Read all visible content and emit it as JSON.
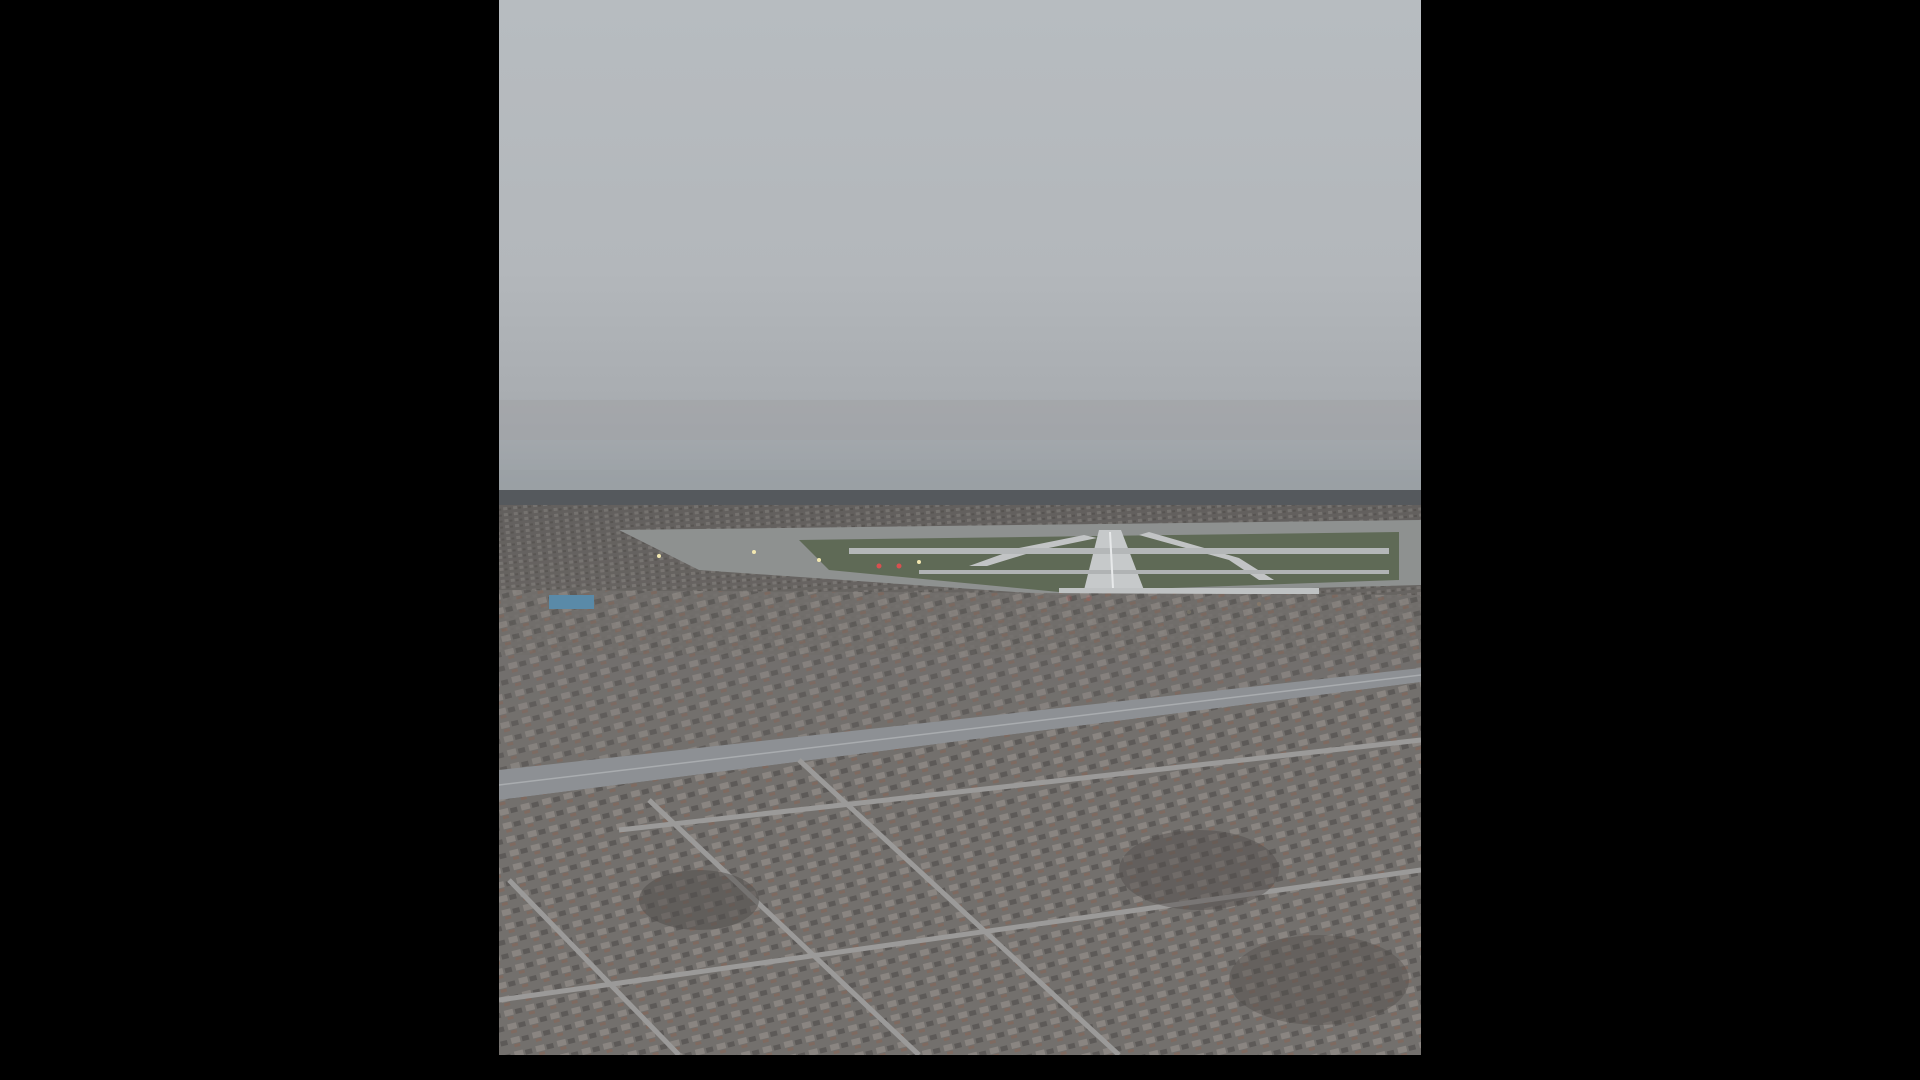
{
  "video_player": {
    "letterbox_color": "#000000",
    "frame": {
      "scene": "aerial-view-airport-approach",
      "sky_color": "#b6bbbf",
      "horizon_color": "#7e858b",
      "ground_color": "#6f6a66",
      "runway_color": "#c8cacb",
      "grass_color": "#5f6a56",
      "highway_color": "#8d9094"
    }
  }
}
